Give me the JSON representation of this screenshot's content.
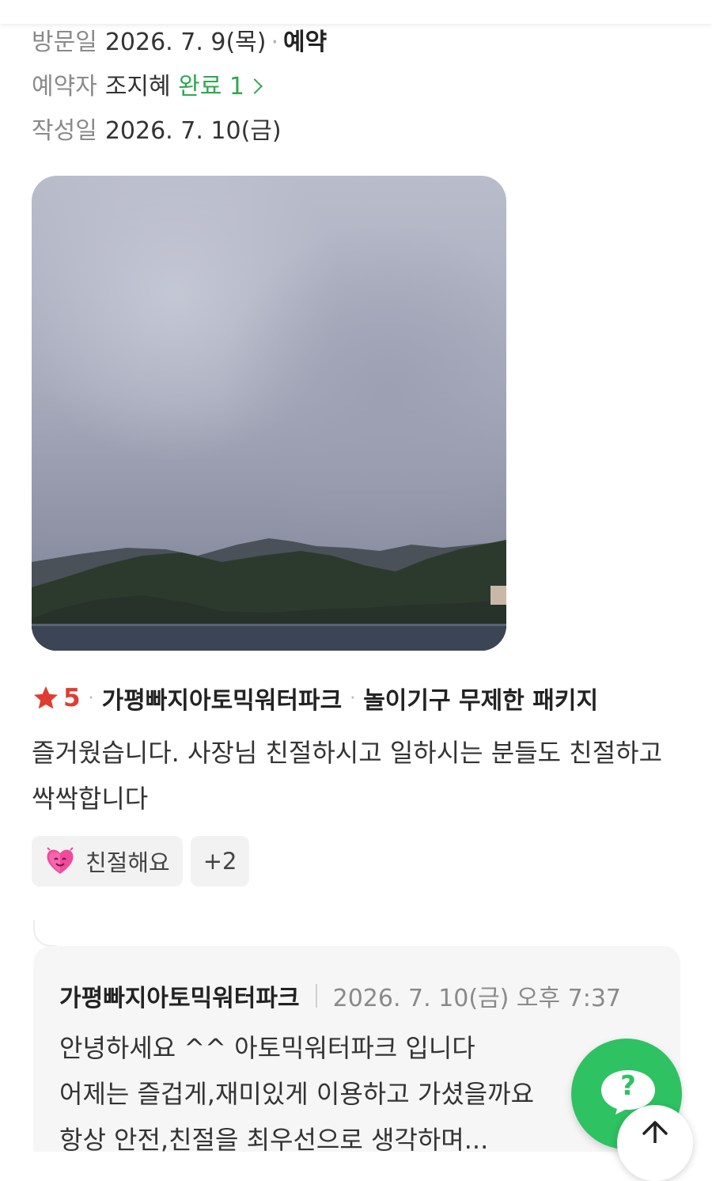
{
  "meta": {
    "visit_label": "방문일",
    "visit_date": "2026. 7. 9(목)",
    "visit_type": "예약",
    "reserver_label": "예약자",
    "reserver_name": "조지혜",
    "reserver_status": "완료 1",
    "written_label": "작성일",
    "written_date": "2026. 7. 10(금)"
  },
  "rating": {
    "score": "5",
    "place": "가평빠지아토믹워터파크",
    "product": "놀이기구 무제한 패키지",
    "star_color": "#e03c31"
  },
  "review_text": "즐거웠습니다. 사장님 친절하시고 일하시는 분들도 친절하고 싹싹합니다",
  "tags": [
    {
      "label": "친절해요",
      "icon": "smiling-heart-icon"
    },
    {
      "label": "+2"
    }
  ],
  "reply": {
    "name": "가평빠지아토믹워터파크",
    "date": "2026. 7. 10(금) 오후 7:37",
    "body": "안녕하세요 ^^ 아토믹워터파크 입니다\n어제는 즐겁게,재미있게 이용하고 가셨을까요\n항상 안전,친절을 최우선으로 생각하며..."
  },
  "fab": {
    "label": "?",
    "color": "#2ec262"
  },
  "colors": {
    "accent_green": "#2fa84f"
  }
}
